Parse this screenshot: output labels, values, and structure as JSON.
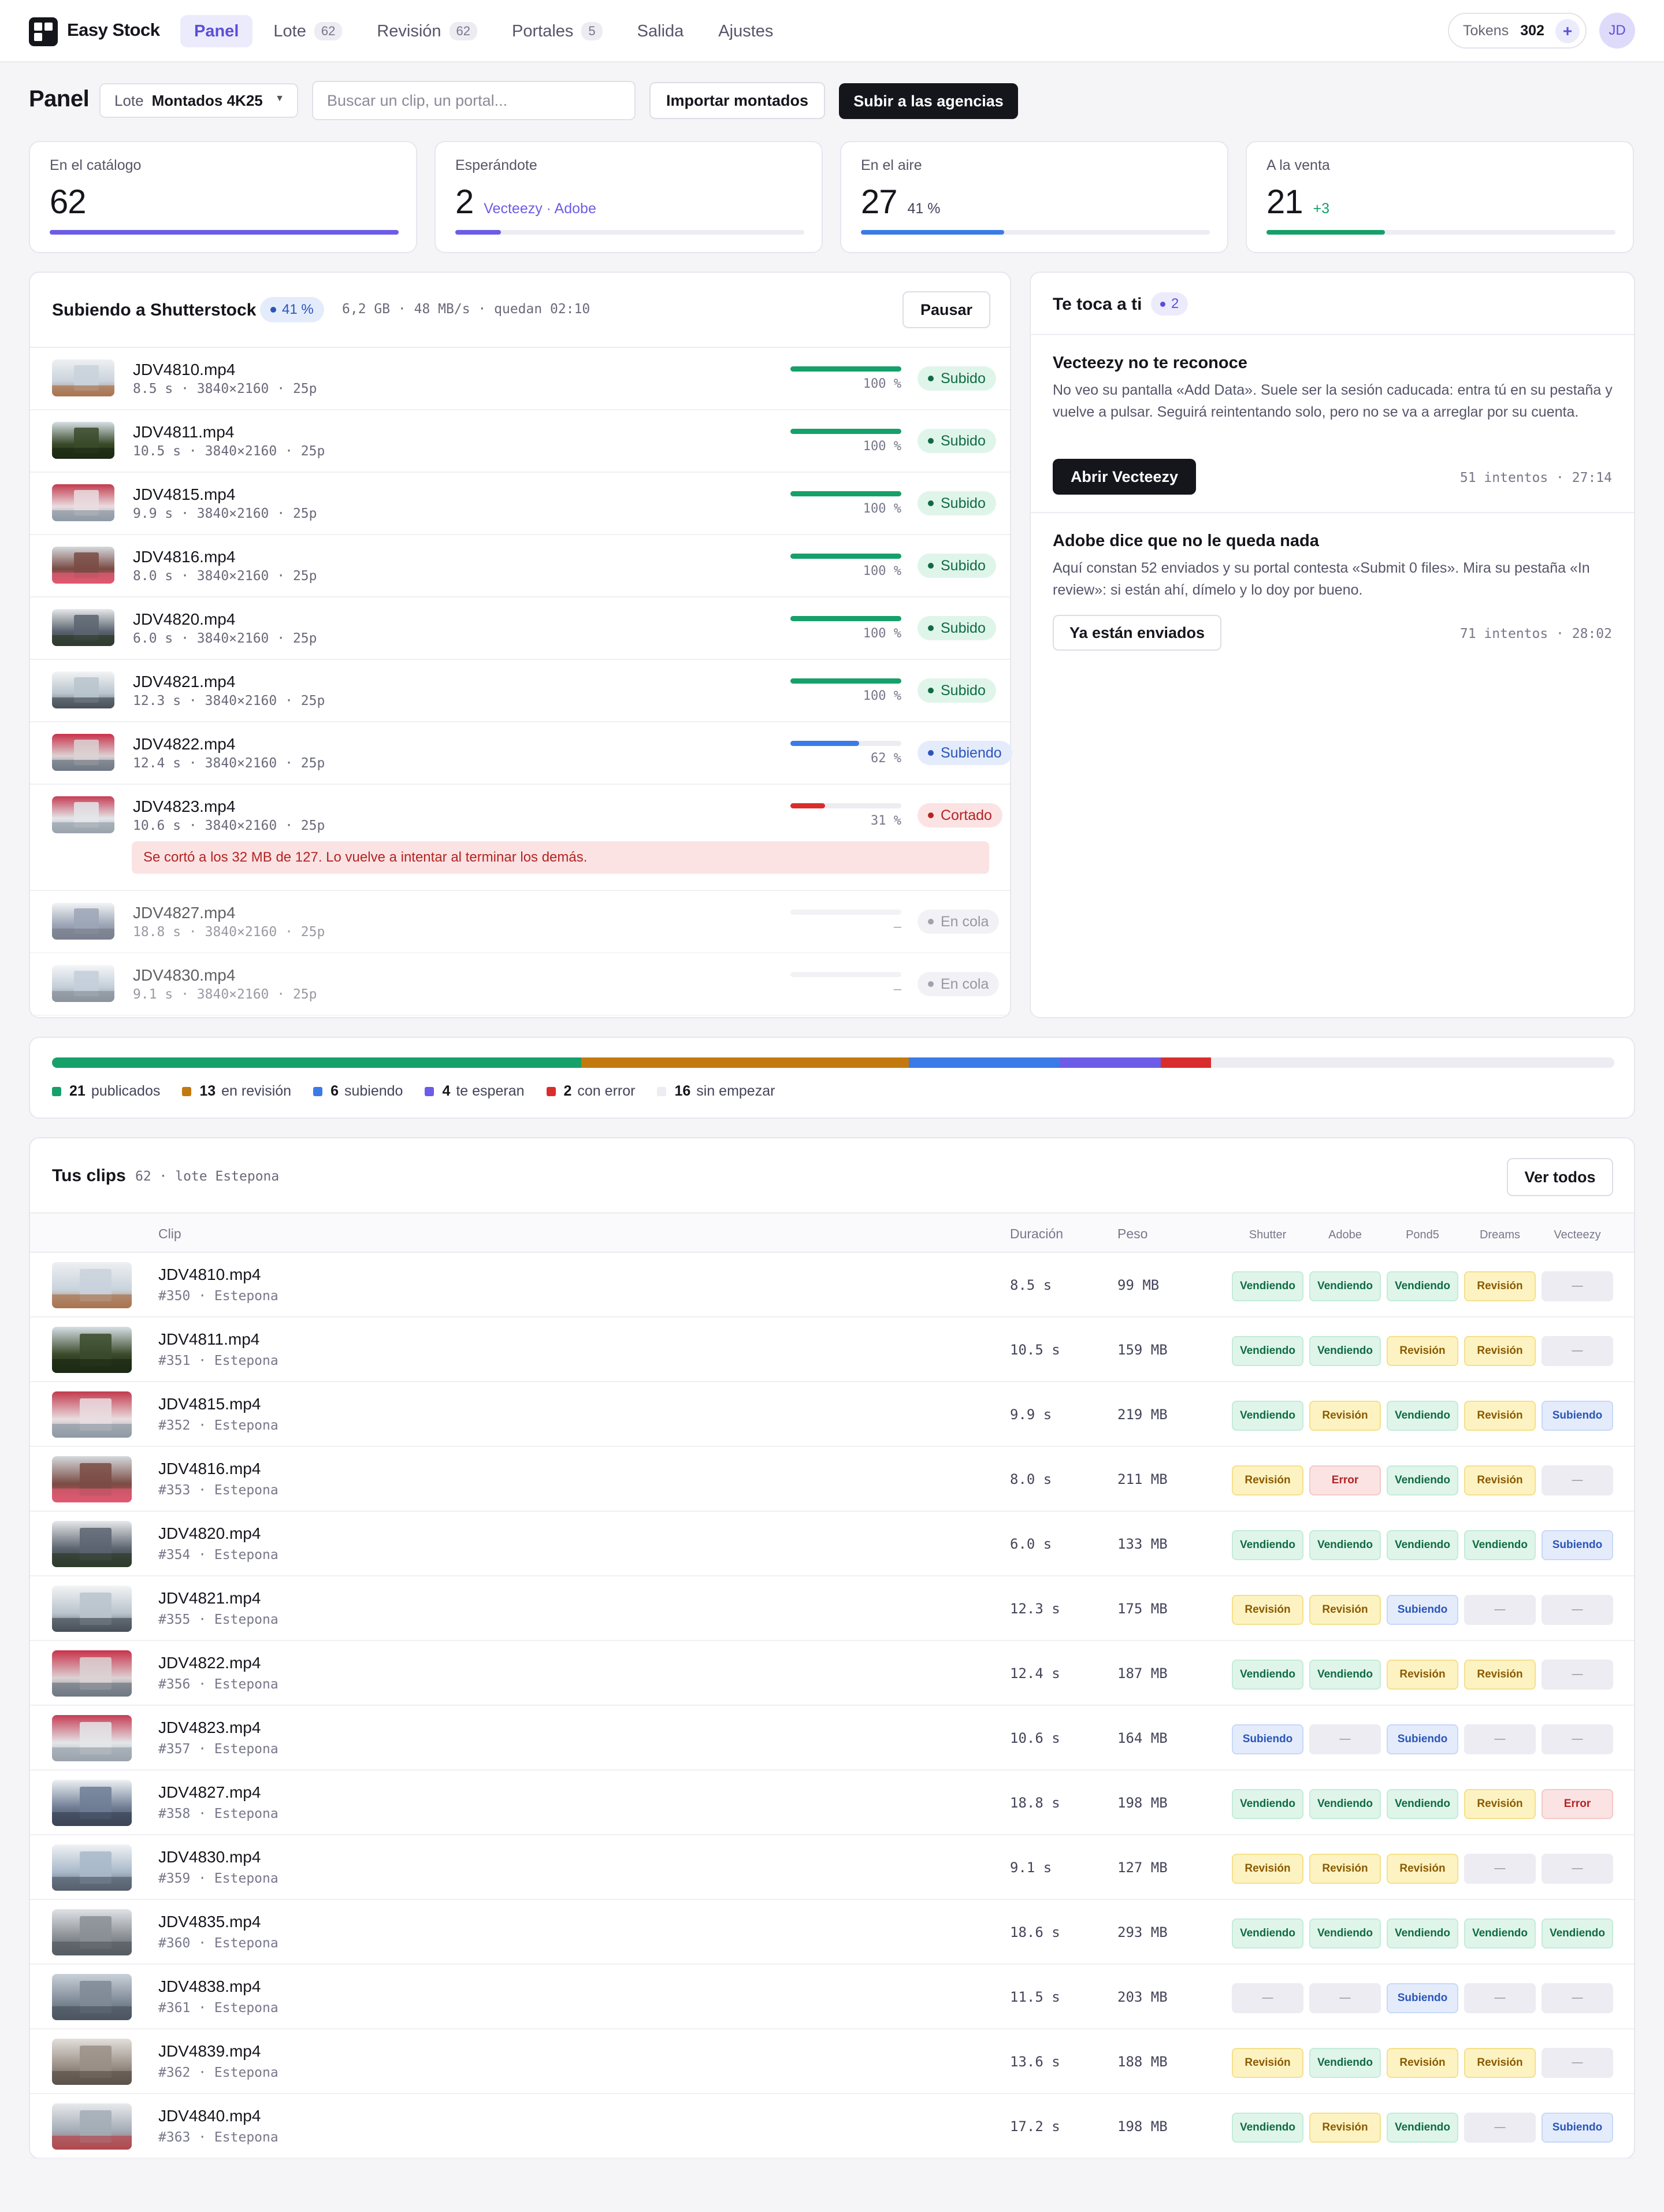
{
  "app": {
    "name": "Easy Stock"
  },
  "nav": [
    {
      "label": "Panel",
      "badge": ""
    },
    {
      "label": "Lote",
      "badge": "62"
    },
    {
      "label": "Revisión",
      "badge": "62"
    },
    {
      "label": "Portales",
      "badge": "5"
    },
    {
      "label": "Salida",
      "badge": ""
    },
    {
      "label": "Ajustes",
      "badge": ""
    }
  ],
  "header": {
    "tokens_label": "Tokens",
    "tokens_value": "302",
    "tokens_add": "+",
    "avatar": "JD"
  },
  "toolbar": {
    "title": "Panel",
    "lote_label": "Lote",
    "lote_value": "Montados 4K25",
    "search_placeholder": "Buscar un clip, un portal...",
    "import_label": "Importar montados",
    "upload_label": "Subir a las agencias"
  },
  "stats": [
    {
      "label": "En el catálogo",
      "value": "62",
      "sub": "",
      "progress": 1.0,
      "color": "#6c5ce7"
    },
    {
      "label": "Esperándote",
      "value": "2",
      "sub": "Vecteezy · Adobe",
      "progress": 0.13,
      "color": "#6c5ce7"
    },
    {
      "label": "En el aire",
      "value": "27",
      "sub": "41 %",
      "progress": 0.41,
      "color": "#3b7be8"
    },
    {
      "label": "A la venta",
      "value": "21",
      "sub": "+3",
      "progress": 0.34,
      "color": "#16a06a"
    }
  ],
  "upload": {
    "title": "Subiendo a Shutterstock",
    "percent": "41 %",
    "meta": "6,2 GB · 48 MB/s · quedan 02:10",
    "pause_label": "Pausar",
    "rows": [
      {
        "name": "JDV4810.mp4",
        "meta": "8.5 s · 3840×2160 · 25p",
        "progress": 1.0,
        "pct": "100 %",
        "status": "Subido",
        "kind": "green"
      },
      {
        "name": "JDV4811.mp4",
        "meta": "10.5 s · 3840×2160 · 25p",
        "progress": 1.0,
        "pct": "100 %",
        "status": "Subido",
        "kind": "green"
      },
      {
        "name": "JDV4815.mp4",
        "meta": "9.9 s · 3840×2160 · 25p",
        "progress": 1.0,
        "pct": "100 %",
        "status": "Subido",
        "kind": "green"
      },
      {
        "name": "JDV4816.mp4",
        "meta": "8.0 s · 3840×2160 · 25p",
        "progress": 1.0,
        "pct": "100 %",
        "status": "Subido",
        "kind": "green"
      },
      {
        "name": "JDV4820.mp4",
        "meta": "6.0 s · 3840×2160 · 25p",
        "progress": 1.0,
        "pct": "100 %",
        "status": "Subido",
        "kind": "green"
      },
      {
        "name": "JDV4821.mp4",
        "meta": "12.3 s · 3840×2160 · 25p",
        "progress": 1.0,
        "pct": "100 %",
        "status": "Subido",
        "kind": "green"
      },
      {
        "name": "JDV4822.mp4",
        "meta": "12.4 s · 3840×2160 · 25p",
        "progress": 0.62,
        "pct": "62 %",
        "status": "Subiendo",
        "kind": "blue"
      },
      {
        "name": "JDV4823.mp4",
        "meta": "10.6 s · 3840×2160 · 25p",
        "progress": 0.31,
        "pct": "31 %",
        "status": "Cortado",
        "kind": "red",
        "note": "Se cortó a los 32 MB de 127. Lo vuelve a intentar al terminar los demás."
      },
      {
        "name": "JDV4827.mp4",
        "meta": "18.8 s · 3840×2160 · 25p",
        "progress": 0,
        "pct": "—",
        "status": "En cola",
        "kind": "gray"
      },
      {
        "name": "JDV4830.mp4",
        "meta": "9.1 s · 3840×2160 · 25p",
        "progress": 0,
        "pct": "—",
        "status": "En cola",
        "kind": "gray"
      }
    ]
  },
  "tasks": {
    "title": "Te toca a ti",
    "count": "2",
    "items": [
      {
        "title": "Vecteezy no te reconoce",
        "body": "No veo su pantalla «Add Data». Suele ser la sesión caducada: entra tú en su pestaña y vuelve a pulsar. Seguirá reintentando solo, pero no se va a arreglar por su cuenta.",
        "action": "Abrir Vecteezy",
        "meta": "51 intentos · 27:14"
      },
      {
        "title": "Adobe dice que no le queda nada",
        "body": "Aquí constan 52 enviados y su portal contesta «Submit 0 files». Mira su pestaña «In review»: si están ahí, dímelo y lo doy por bueno.",
        "action": "Ya están enviados",
        "meta": "71 intentos · 28:02"
      }
    ]
  },
  "summary": {
    "total": 62,
    "segments": [
      {
        "count": "21",
        "label": "publicados",
        "color": "#16a06a"
      },
      {
        "count": "13",
        "label": "en revisión",
        "color": "#c27a0e"
      },
      {
        "count": "6",
        "label": "subiendo",
        "color": "#3b7be8"
      },
      {
        "count": "4",
        "label": "te esperan",
        "color": "#6c5ce7"
      },
      {
        "count": "2",
        "label": "con error",
        "color": "#d92d2d"
      },
      {
        "count": "16",
        "label": "sin empezar",
        "color": "#ececf2"
      }
    ]
  },
  "clips": {
    "title": "Tus clips",
    "meta": "62 · lote Estepona",
    "view_all": "Ver todos",
    "columns": {
      "clip": "Clip",
      "duration": "Duración",
      "size": "Peso",
      "portals": [
        "Shutter",
        "Adobe",
        "Pond5",
        "Dreams",
        "Vecteezy"
      ]
    },
    "status_labels": {
      "v": "Vendiendo",
      "r": "Revisión",
      "s": "Subiendo",
      "e": "Error",
      "n": "—"
    },
    "rows": [
      {
        "name": "JDV4810.mp4",
        "sub": "#350 · Estepona",
        "duration": "8.5 s",
        "size": "99 MB",
        "portals": [
          "v",
          "v",
          "v",
          "r",
          "n"
        ]
      },
      {
        "name": "JDV4811.mp4",
        "sub": "#351 · Estepona",
        "duration": "10.5 s",
        "size": "159 MB",
        "portals": [
          "v",
          "v",
          "r",
          "r",
          "n"
        ]
      },
      {
        "name": "JDV4815.mp4",
        "sub": "#352 · Estepona",
        "duration": "9.9 s",
        "size": "219 MB",
        "portals": [
          "v",
          "r",
          "v",
          "r",
          "s"
        ]
      },
      {
        "name": "JDV4816.mp4",
        "sub": "#353 · Estepona",
        "duration": "8.0 s",
        "size": "211 MB",
        "portals": [
          "r",
          "e",
          "v",
          "r",
          "n"
        ]
      },
      {
        "name": "JDV4820.mp4",
        "sub": "#354 · Estepona",
        "duration": "6.0 s",
        "size": "133 MB",
        "portals": [
          "v",
          "v",
          "v",
          "v",
          "s"
        ]
      },
      {
        "name": "JDV4821.mp4",
        "sub": "#355 · Estepona",
        "duration": "12.3 s",
        "size": "175 MB",
        "portals": [
          "r",
          "r",
          "s",
          "n",
          "n"
        ]
      },
      {
        "name": "JDV4822.mp4",
        "sub": "#356 · Estepona",
        "duration": "12.4 s",
        "size": "187 MB",
        "portals": [
          "v",
          "v",
          "r",
          "r",
          "n"
        ]
      },
      {
        "name": "JDV4823.mp4",
        "sub": "#357 · Estepona",
        "duration": "10.6 s",
        "size": "164 MB",
        "portals": [
          "s",
          "n",
          "s",
          "n",
          "n"
        ]
      },
      {
        "name": "JDV4827.mp4",
        "sub": "#358 · Estepona",
        "duration": "18.8 s",
        "size": "198 MB",
        "portals": [
          "v",
          "v",
          "v",
          "r",
          "e"
        ]
      },
      {
        "name": "JDV4830.mp4",
        "sub": "#359 · Estepona",
        "duration": "9.1 s",
        "size": "127 MB",
        "portals": [
          "r",
          "r",
          "r",
          "n",
          "n"
        ]
      },
      {
        "name": "JDV4835.mp4",
        "sub": "#360 · Estepona",
        "duration": "18.6 s",
        "size": "293 MB",
        "portals": [
          "v",
          "v",
          "v",
          "v",
          "v"
        ]
      },
      {
        "name": "JDV4838.mp4",
        "sub": "#361 · Estepona",
        "duration": "11.5 s",
        "size": "203 MB",
        "portals": [
          "n",
          "n",
          "s",
          "n",
          "n"
        ]
      },
      {
        "name": "JDV4839.mp4",
        "sub": "#362 · Estepona",
        "duration": "13.6 s",
        "size": "188 MB",
        "portals": [
          "r",
          "v",
          "r",
          "r",
          "n"
        ]
      },
      {
        "name": "JDV4840.mp4",
        "sub": "#363 · Estepona",
        "duration": "17.2 s",
        "size": "198 MB",
        "portals": [
          "v",
          "r",
          "v",
          "n",
          "s"
        ]
      }
    ]
  }
}
